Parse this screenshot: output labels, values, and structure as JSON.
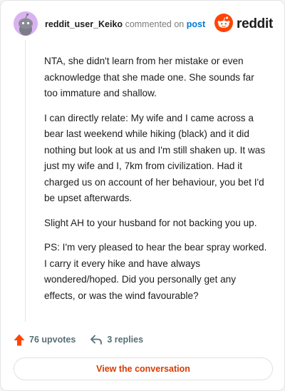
{
  "header": {
    "username": "reddit_user_Keiko",
    "action_text": "commented on",
    "post_link": "post",
    "brand_wordmark": "reddit"
  },
  "comment": {
    "paragraphs": [
      "NTA, she didn't learn from her mistake or even acknowledge that she made one. She sounds far too immature and shallow.",
      "I can directly relate: My wife and I came across a bear last weekend while hiking (black) and it did nothing but look at us and I'm still shaken up. It was just my wife and I, 7km from civilization. Had it charged us on account of her behaviour, you bet I'd be upset afterwards.",
      "Slight AH to your husband for not backing you up.",
      "PS: I'm very pleased to hear the bear spray worked. I carry it every hike and have always wondered/hoped. Did you personally get any effects, or was the wind favourable?"
    ]
  },
  "actions": {
    "upvotes_label": "76 upvotes",
    "replies_label": "3 replies"
  },
  "cta": {
    "label": "View the conversation"
  },
  "icons": {
    "avatar": "snoo-avatar-icon",
    "brand": "reddit-logo-icon",
    "upvote": "upvote-arrow-icon",
    "reply": "reply-arrow-icon"
  },
  "colors": {
    "brand_orange": "#ff4500",
    "upvote_orange": "#ff4500",
    "link_blue": "#0079d3",
    "cta_text": "#d93a00",
    "avatar_bg": "#d9b3ef"
  }
}
